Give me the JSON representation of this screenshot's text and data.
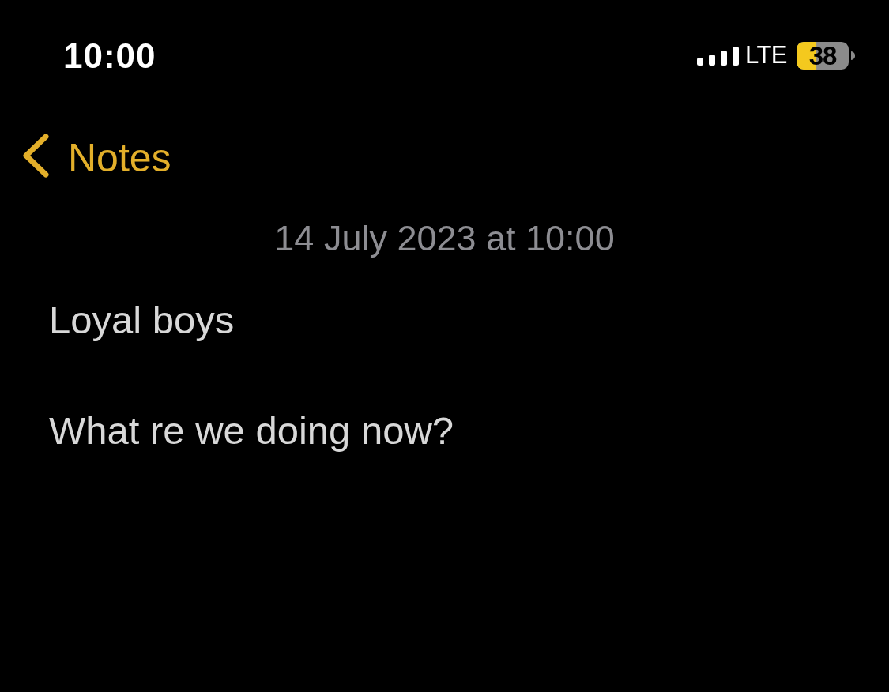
{
  "status_bar": {
    "time": "10:00",
    "network": "LTE",
    "battery_percent": "38",
    "low_power_mode": true
  },
  "navigation": {
    "back_label": "Notes"
  },
  "note": {
    "date": "14 July 2023 at 10:00",
    "lines": [
      "Loyal boys",
      "What re we doing now?"
    ]
  }
}
